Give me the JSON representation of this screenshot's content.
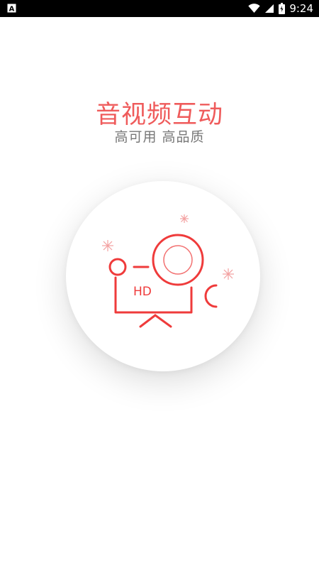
{
  "status_bar": {
    "time": "9:24",
    "left_icon": "notification-a-icon",
    "icons": [
      "wifi-icon",
      "signal-icon",
      "battery-icon"
    ]
  },
  "splash": {
    "title": "音视频互动",
    "subtitle": "高可用 高品质",
    "illustration": {
      "icon": "hd-video-conference-icon",
      "label": "HD"
    }
  },
  "colors": {
    "accent": "#ef3b3b",
    "title": "#ef5b5b",
    "subtitle": "#777777",
    "status_bar": "#000000"
  }
}
